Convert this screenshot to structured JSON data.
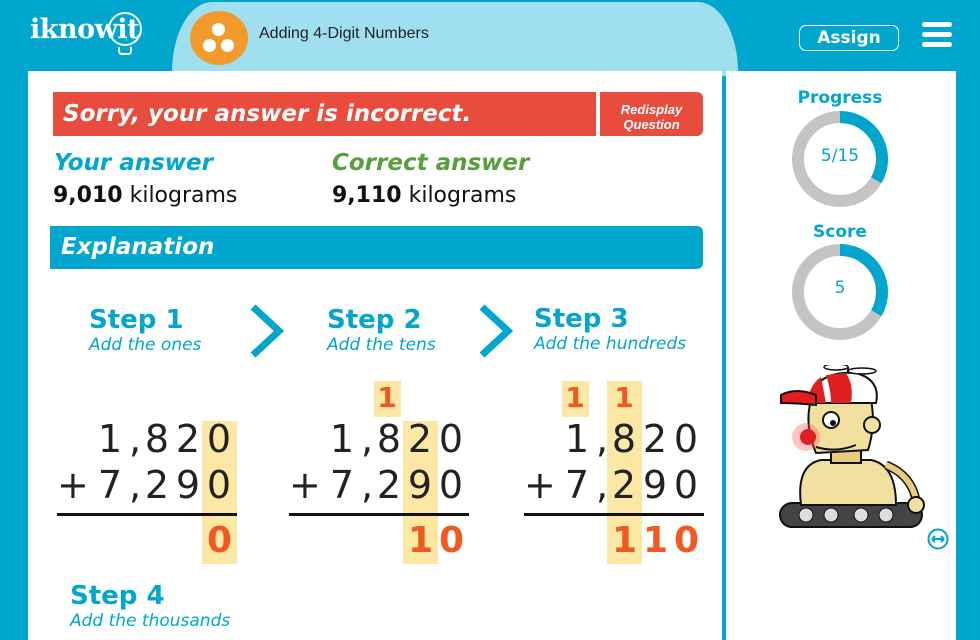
{
  "header": {
    "logo": "iknowit",
    "lesson_title": "Adding 4-Digit Numbers",
    "lesson_icon": "three-dots-icon",
    "assign_label": "Assign",
    "menu_icon": "hamburger-menu-icon"
  },
  "feedback": {
    "message": "Sorry, your answer is incorrect.",
    "redisplay_line1": "Redisplay",
    "redisplay_line2": "Question",
    "your_answer_label": "Your answer",
    "your_answer_number": "9,010",
    "your_answer_unit": " kilograms",
    "correct_answer_label": "Correct answer",
    "correct_answer_number": "9,110",
    "correct_answer_unit": " kilograms"
  },
  "explanation": {
    "title": "Explanation",
    "steps": [
      {
        "title": "Step 1",
        "subtitle": "Add the ones"
      },
      {
        "title": "Step 2",
        "subtitle": "Add the tens"
      },
      {
        "title": "Step 3",
        "subtitle": "Add the hundreds"
      },
      {
        "title": "Step 4",
        "subtitle": "Add the thousands"
      }
    ],
    "problem": {
      "addend1": [
        "1",
        ",",
        "8",
        "2",
        "0"
      ],
      "addend2": [
        "7",
        ",",
        "2",
        "9",
        "0"
      ],
      "operator": "+"
    },
    "calcs": [
      {
        "carries": [],
        "sum": [
          "0"
        ],
        "highlight_col": "ones"
      },
      {
        "carries": [
          "1"
        ],
        "sum": [
          "1",
          "0"
        ],
        "highlight_col": "tens"
      },
      {
        "carries": [
          "1",
          "1"
        ],
        "sum": [
          "1",
          "1",
          "0"
        ],
        "highlight_col": "hundreds"
      }
    ]
  },
  "sidebar": {
    "progress_label": "Progress",
    "progress_text": "5/15",
    "progress_fraction": 0.3333,
    "score_label": "Score",
    "score_text": "5",
    "score_fraction": 0.3333,
    "mascot": "robot-mascot",
    "expand_icon": "expand-arrows-icon"
  },
  "colors": {
    "brand_blue": "#00a6cd",
    "light_blue": "#a0dff0",
    "error_red": "#e84c3d",
    "correct_green": "#58a03c",
    "highlight": "#fde7a5",
    "sum_orange": "#f05a22",
    "ring_gray": "#c4c4c4"
  }
}
